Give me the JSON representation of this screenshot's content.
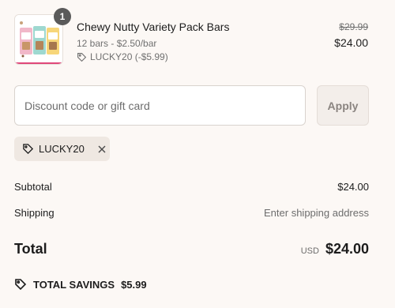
{
  "product": {
    "title": "Chewy Nutty Variety Pack Bars",
    "variant": "12 bars - $2.50/bar",
    "discount_applied": "LUCKY20 (-$5.99)",
    "price_original": "$29.99",
    "price_current": "$24.00",
    "quantity": "1",
    "thumbnail_icon": "product-variety-pack-image"
  },
  "discount": {
    "placeholder": "Discount code or gift card",
    "value": "",
    "apply_label": "Apply"
  },
  "applied_code": {
    "code": "LUCKY20",
    "icon": "tag-icon",
    "remove_icon": "close-icon"
  },
  "summary": {
    "subtotal_label": "Subtotal",
    "subtotal_value": "$24.00",
    "shipping_label": "Shipping",
    "shipping_value": "Enter shipping address",
    "total_label": "Total",
    "currency": "USD",
    "total_value": "$24.00",
    "savings_label": "TOTAL SAVINGS",
    "savings_value": "$5.99"
  },
  "colors": {
    "background": "#fcf8f5",
    "chip_background": "#efe8e2",
    "badge": "#5a5a5a"
  }
}
